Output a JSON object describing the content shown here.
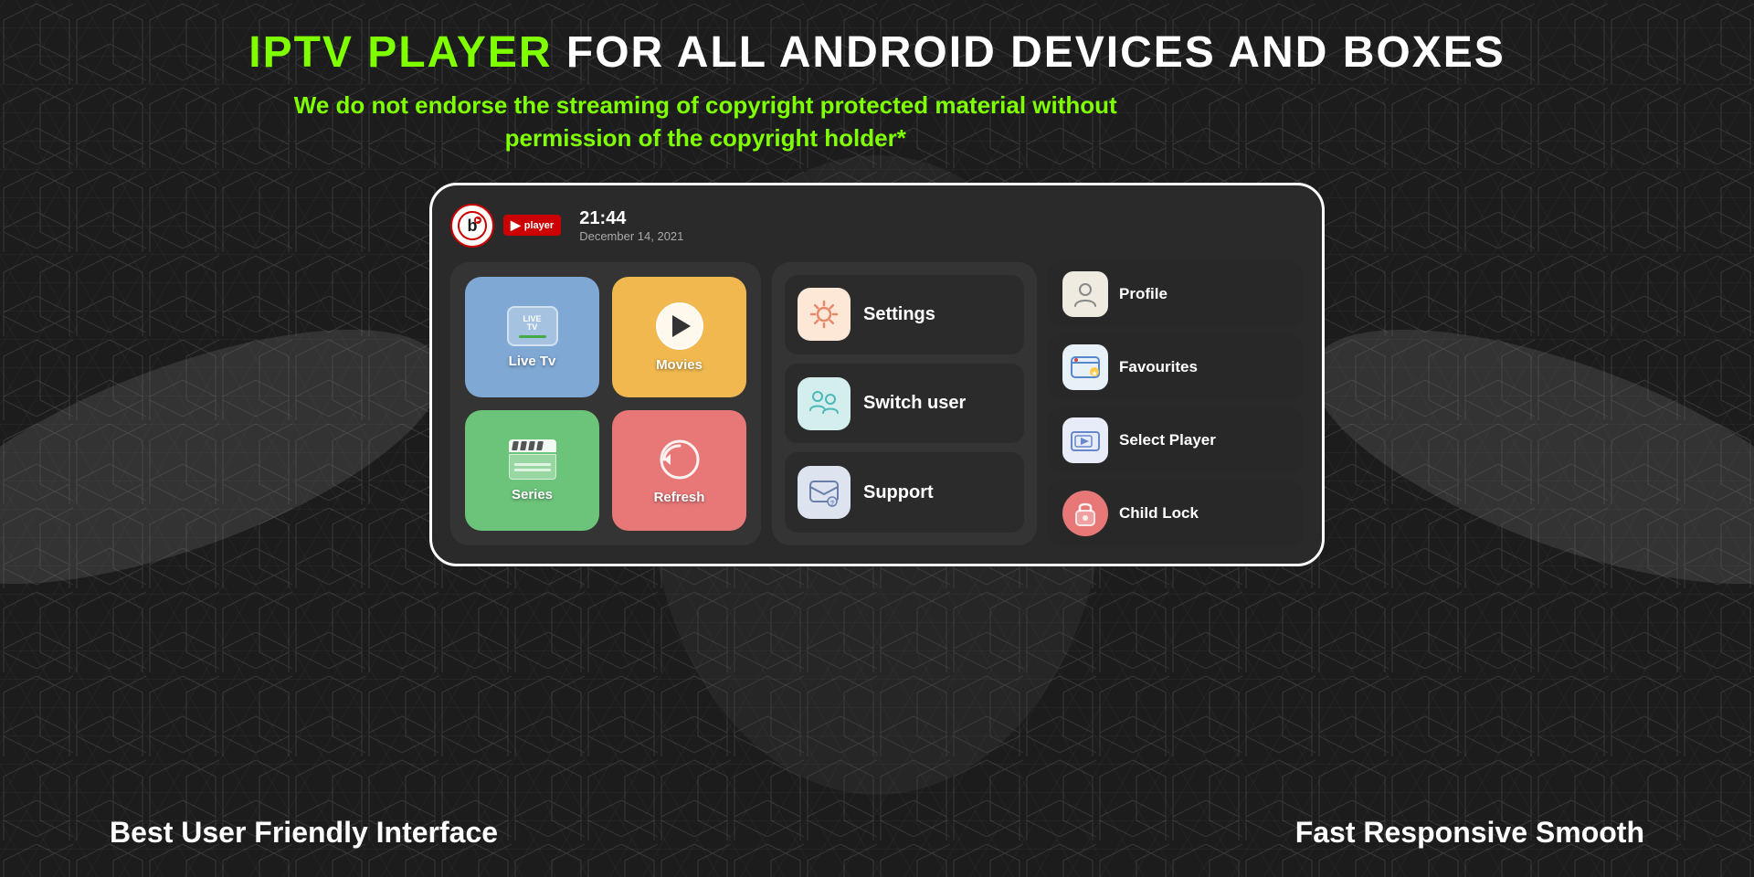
{
  "header": {
    "title_green": "IPTV PLAYER",
    "title_white": " FOR ALL ANDROID DEVICES AND BOXES",
    "subtitle": "We do not endorse the streaming of copyright protected material without permission of the copyright holder*"
  },
  "device": {
    "time": "21:44",
    "date": "December 14, 2021",
    "logo_letter": "b"
  },
  "grid_items": [
    {
      "label": "Live Tv",
      "type": "live-tv"
    },
    {
      "label": "Movies",
      "type": "movies"
    },
    {
      "label": "Series",
      "type": "series"
    },
    {
      "label": "Refresh",
      "type": "refresh"
    }
  ],
  "middle_items": [
    {
      "label": "Settings",
      "icon": "settings"
    },
    {
      "label": "Switch user",
      "icon": "switch-user"
    },
    {
      "label": "Support",
      "icon": "support"
    }
  ],
  "right_items": [
    {
      "label": "Profile",
      "icon": "profile"
    },
    {
      "label": "Favourites",
      "icon": "favourites"
    },
    {
      "label": "Select Player",
      "icon": "player"
    },
    {
      "label": "Child Lock",
      "icon": "childlock"
    }
  ],
  "bottom": {
    "left": "Best User Friendly Interface",
    "right": "Fast Responsive Smooth"
  }
}
